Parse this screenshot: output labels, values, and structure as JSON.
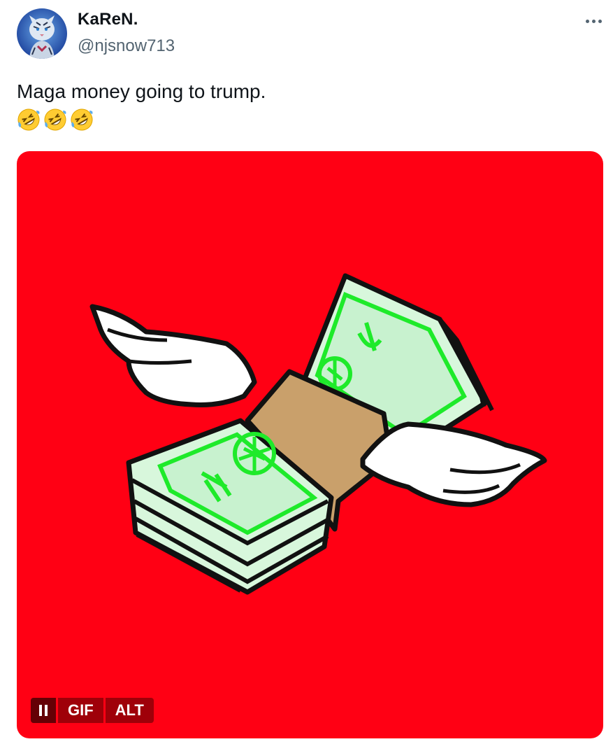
{
  "tweet": {
    "author": {
      "display_name": "KaReN.",
      "handle": "@njsnow713",
      "avatar_icon": "tiger-avatar-icon"
    },
    "text": "Maga money going to trump.",
    "emojis": [
      "rolling-on-floor-laughing-emoji",
      "rolling-on-floor-laughing-emoji",
      "rolling-on-floor-laughing-emoji"
    ],
    "more_icon": "more-dots-icon",
    "media": {
      "type": "gif",
      "background_color": "#ff0014",
      "illustration": "flying-money-stack-with-wings",
      "controls": {
        "pause_icon": "pause-icon",
        "gif_label": "GIF",
        "alt_label": "ALT"
      }
    }
  }
}
